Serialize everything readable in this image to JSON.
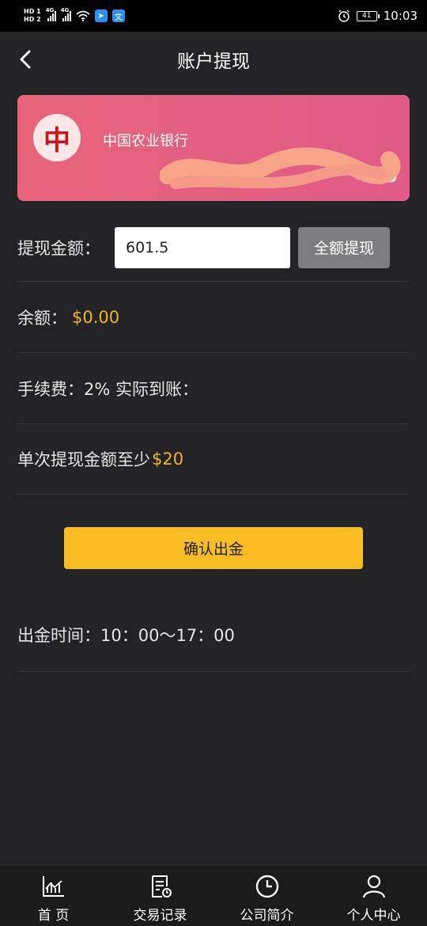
{
  "status_bar": {
    "hd1": "HD 1",
    "hd2": "HD 2",
    "net1": "4G",
    "net2": "4G",
    "battery": "41",
    "time": "10:03",
    "icons": [
      "signal-icon",
      "wifi-icon",
      "app-icon",
      "translate-icon",
      "alarm-icon",
      "battery-icon"
    ]
  },
  "header": {
    "title": "账户提现",
    "back_icon": "chevron-left-icon"
  },
  "bank_card": {
    "logo_char": "中",
    "bank_name": "中国农业银行",
    "card_number_suffix": "470",
    "colors": {
      "start": "#e7647a",
      "end": "#e05b88"
    }
  },
  "withdraw": {
    "amount_label": "提现金额：",
    "amount_value": "601.5",
    "full_button": "全额提现"
  },
  "balance": {
    "label": "余额：",
    "value": "$0.00"
  },
  "fee": {
    "label": "手续费：2% 实际到账："
  },
  "minimum": {
    "label": "单次提现金额至少",
    "value": "$20"
  },
  "confirm_button": "确认出金",
  "time": {
    "label": "出金时间：10：00～17：00"
  },
  "bottom_nav": [
    {
      "label": "首 页",
      "icon": "chart-icon"
    },
    {
      "label": "交易记录",
      "icon": "receipt-icon"
    },
    {
      "label": "公司简介",
      "icon": "clock-icon"
    },
    {
      "label": "个人中心",
      "icon": "user-icon"
    }
  ],
  "colors": {
    "background": "#232325",
    "accent": "#f4b41e",
    "button_gold": "#f7bd22",
    "button_gray": "#7d7d7f"
  }
}
